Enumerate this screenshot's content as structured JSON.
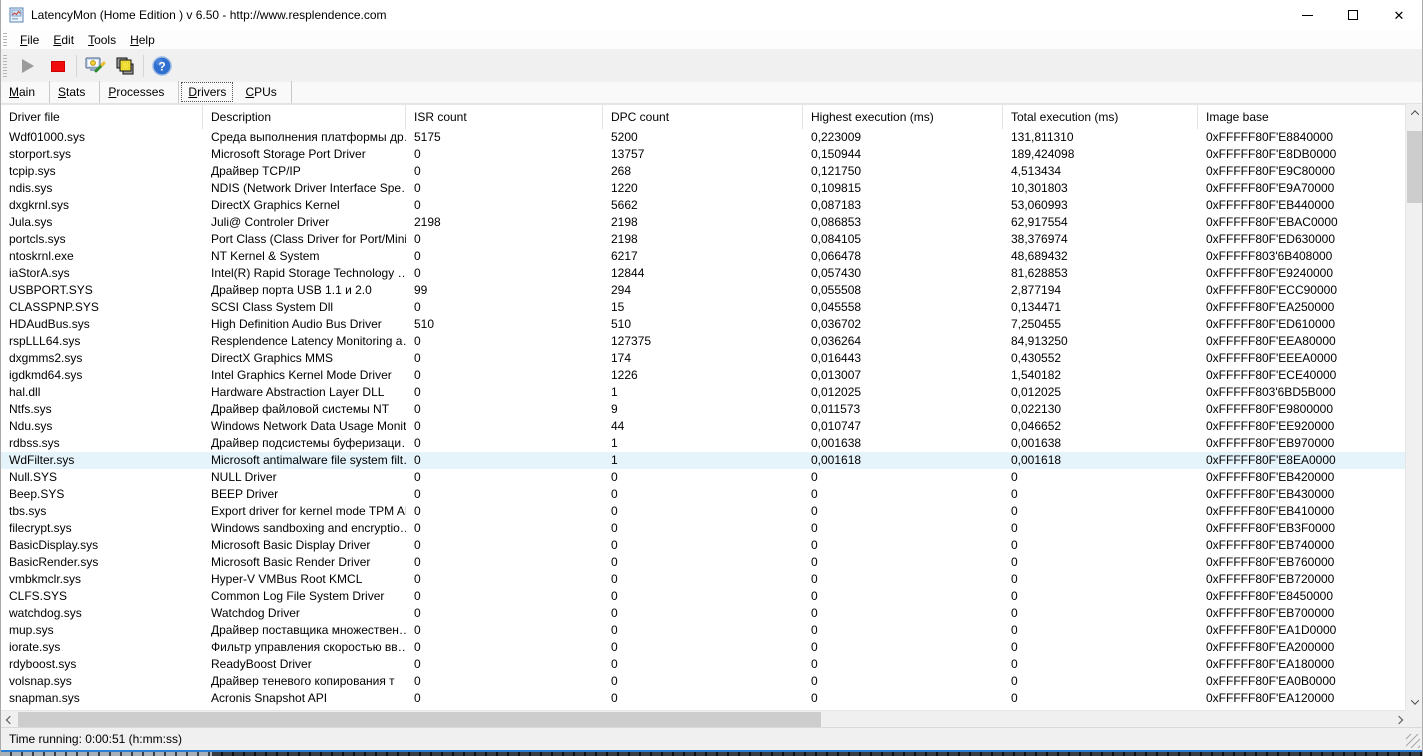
{
  "window": {
    "title": "LatencyMon  (Home Edition )  v 6.50 - http://www.resplendence.com",
    "controls": [
      "minimize",
      "maximize",
      "close"
    ],
    "close_glyph": "✕"
  },
  "menu": {
    "items": [
      {
        "label": "File"
      },
      {
        "label": "Edit"
      },
      {
        "label": "Tools"
      },
      {
        "label": "Help"
      }
    ]
  },
  "toolbar": {
    "icons": [
      "play-icon",
      "stop-icon",
      "analyze-report-icon",
      "processes-icon",
      "help-icon"
    ]
  },
  "tabs": {
    "items": [
      {
        "label": "Main"
      },
      {
        "label": "Stats"
      },
      {
        "label": "Processes"
      },
      {
        "label": "Drivers",
        "active": true
      },
      {
        "label": "CPUs"
      }
    ]
  },
  "table": {
    "columns": [
      "Driver file",
      "Description",
      "ISR count",
      "DPC count",
      "Highest execution (ms)",
      "Total execution (ms)",
      "Image base"
    ],
    "highlighted_index": 19,
    "rows": [
      [
        "Wdf01000.sys",
        "Среда выполнения платформы др…",
        "5175",
        "5200",
        "0,223009",
        "131,811310",
        "0xFFFFF80F'E8840000"
      ],
      [
        "storport.sys",
        "Microsoft Storage Port Driver",
        "0",
        "13757",
        "0,150944",
        "189,424098",
        "0xFFFFF80F'E8DB0000"
      ],
      [
        "tcpip.sys",
        "Драйвер TCP/IP",
        "0",
        "268",
        "0,121750",
        "4,513434",
        "0xFFFFF80F'E9C80000"
      ],
      [
        "ndis.sys",
        "NDIS (Network Driver Interface Spe…",
        "0",
        "1220",
        "0,109815",
        "10,301803",
        "0xFFFFF80F'E9A70000"
      ],
      [
        "dxgkrnl.sys",
        "DirectX Graphics Kernel",
        "0",
        "5662",
        "0,087183",
        "53,060993",
        "0xFFFFF80F'EB440000"
      ],
      [
        "Jula.sys",
        "Juli@ Controler Driver",
        "2198",
        "2198",
        "0,086853",
        "62,917554",
        "0xFFFFF80F'EBAC0000"
      ],
      [
        "portcls.sys",
        "Port Class (Class Driver for Port/Mini…",
        "0",
        "2198",
        "0,084105",
        "38,376974",
        "0xFFFFF80F'ED630000"
      ],
      [
        "ntoskrnl.exe",
        "NT Kernel & System",
        "0",
        "6217",
        "0,066478",
        "48,689432",
        "0xFFFFF803'6B408000"
      ],
      [
        "iaStorA.sys",
        "Intel(R) Rapid Storage Technology …",
        "0",
        "12844",
        "0,057430",
        "81,628853",
        "0xFFFFF80F'E9240000"
      ],
      [
        "USBPORT.SYS",
        "Драйвер порта USB 1.1 и 2.0",
        "99",
        "294",
        "0,055508",
        "2,877194",
        "0xFFFFF80F'ECC90000"
      ],
      [
        "CLASSPNP.SYS",
        "SCSI Class System Dll",
        "0",
        "15",
        "0,045558",
        "0,134471",
        "0xFFFFF80F'EA250000"
      ],
      [
        "HDAudBus.sys",
        "High Definition Audio Bus Driver",
        "510",
        "510",
        "0,036702",
        "7,250455",
        "0xFFFFF80F'ED610000"
      ],
      [
        "rspLLL64.sys",
        "Resplendence Latency Monitoring a…",
        "0",
        "127375",
        "0,036264",
        "84,913250",
        "0xFFFFF80F'EEA80000"
      ],
      [
        "dxgmms2.sys",
        "DirectX Graphics MMS",
        "0",
        "174",
        "0,016443",
        "0,430552",
        "0xFFFFF80F'EEEA0000"
      ],
      [
        "igdkmd64.sys",
        "Intel Graphics Kernel Mode Driver",
        "0",
        "1226",
        "0,013007",
        "1,540182",
        "0xFFFFF80F'ECE40000"
      ],
      [
        "hal.dll",
        "Hardware Abstraction Layer DLL",
        "0",
        "1",
        "0,012025",
        "0,012025",
        "0xFFFFF803'6BD5B000"
      ],
      [
        "Ntfs.sys",
        "Драйвер файловой системы NT",
        "0",
        "9",
        "0,011573",
        "0,022130",
        "0xFFFFF80F'E9800000"
      ],
      [
        "Ndu.sys",
        "Windows Network Data Usage Monit…",
        "0",
        "44",
        "0,010747",
        "0,046652",
        "0xFFFFF80F'EE920000"
      ],
      [
        "rdbss.sys",
        "Драйвер подсистемы буферизаци…",
        "0",
        "1",
        "0,001638",
        "0,001638",
        "0xFFFFF80F'EB970000"
      ],
      [
        "WdFilter.sys",
        "Microsoft antimalware file system filt…",
        "0",
        "1",
        "0,001618",
        "0,001618",
        "0xFFFFF80F'E8EA0000"
      ],
      [
        "Null.SYS",
        "NULL Driver",
        "0",
        "0",
        "0",
        "0",
        "0xFFFFF80F'EB420000"
      ],
      [
        "Beep.SYS",
        "BEEP Driver",
        "0",
        "0",
        "0",
        "0",
        "0xFFFFF80F'EB430000"
      ],
      [
        "tbs.sys",
        "Export driver for kernel mode TPM API",
        "0",
        "0",
        "0",
        "0",
        "0xFFFFF80F'EB410000"
      ],
      [
        "filecrypt.sys",
        "Windows sandboxing and encryptio…",
        "0",
        "0",
        "0",
        "0",
        "0xFFFFF80F'EB3F0000"
      ],
      [
        "BasicDisplay.sys",
        "Microsoft Basic Display Driver",
        "0",
        "0",
        "0",
        "0",
        "0xFFFFF80F'EB740000"
      ],
      [
        "BasicRender.sys",
        "Microsoft Basic Render Driver",
        "0",
        "0",
        "0",
        "0",
        "0xFFFFF80F'EB760000"
      ],
      [
        "vmbkmclr.sys",
        "Hyper-V VMBus Root KMCL",
        "0",
        "0",
        "0",
        "0",
        "0xFFFFF80F'EB720000"
      ],
      [
        "CLFS.SYS",
        "Common Log File System Driver",
        "0",
        "0",
        "0",
        "0",
        "0xFFFFF80F'E8450000"
      ],
      [
        "watchdog.sys",
        "Watchdog Driver",
        "0",
        "0",
        "0",
        "0",
        "0xFFFFF80F'EB700000"
      ],
      [
        "mup.sys",
        "Драйвер поставщика множествен…",
        "0",
        "0",
        "0",
        "0",
        "0xFFFFF80F'EA1D0000"
      ],
      [
        "iorate.sys",
        "Фильтр управления скоростью вв…",
        "0",
        "0",
        "0",
        "0",
        "0xFFFFF80F'EA200000"
      ],
      [
        "rdyboost.sys",
        "ReadyBoost Driver",
        "0",
        "0",
        "0",
        "0",
        "0xFFFFF80F'EA180000"
      ],
      [
        "volsnap.sys",
        "Драйвер теневого копирования т",
        "0",
        "0",
        "0",
        "0",
        "0xFFFFF80F'EA0B0000"
      ],
      [
        "snapman.sys",
        "Acronis Snapshot API",
        "0",
        "0",
        "0",
        "0",
        "0xFFFFF80F'EA120000"
      ]
    ]
  },
  "statusbar": {
    "text": "Time running: 0:00:51  (h:mm:ss)"
  },
  "colors": {
    "highlight_row": "#e5f3fb",
    "toolbar_bg": "#f0f0f0",
    "stop_red": "#f00c0c",
    "help_blue": "#2f6fd0",
    "taskbar_blue": "#2b7cd3"
  }
}
